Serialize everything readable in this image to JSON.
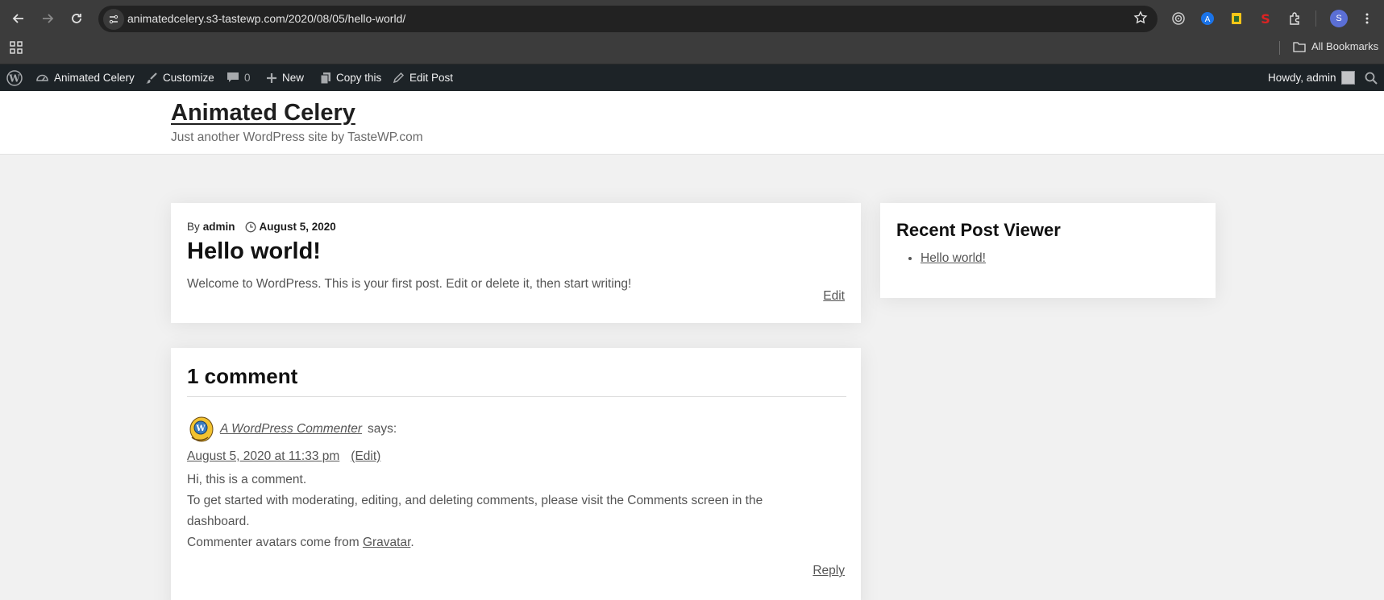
{
  "browser": {
    "url": "animatedcelery.s3-tastewp.com/2020/08/05/hello-world/",
    "profile_initial": "S",
    "bookmarks_label": "All Bookmarks"
  },
  "adminbar": {
    "site_name": "Animated Celery",
    "customize": "Customize",
    "comments_count": "0",
    "new": "New",
    "copy": "Copy this",
    "edit_post": "Edit Post",
    "howdy": "Howdy, admin"
  },
  "site": {
    "title": "Animated Celery",
    "description": "Just another WordPress site by TasteWP.com"
  },
  "post": {
    "by": "By",
    "author": "admin",
    "date": "August 5, 2020",
    "title": "Hello world!",
    "body": "Welcome to WordPress. This is your first post. Edit or delete it, then start writing!",
    "edit": "Edit"
  },
  "comments": {
    "title": "1 comment",
    "author": "A WordPress Commenter",
    "says": "says:",
    "date": "August 5, 2020 at 11:33 pm",
    "edit": "(Edit)",
    "line1": "Hi, this is a comment.",
    "line2": "To get started with moderating, editing, and deleting comments, please visit the Comments screen in the dashboard.",
    "line3_prefix": "Commenter avatars come from",
    "line3_link": "Gravatar",
    "line3_suffix": ".",
    "reply": "Reply"
  },
  "widget": {
    "title": "Recent Post Viewer",
    "items": [
      "Hello world!"
    ]
  }
}
